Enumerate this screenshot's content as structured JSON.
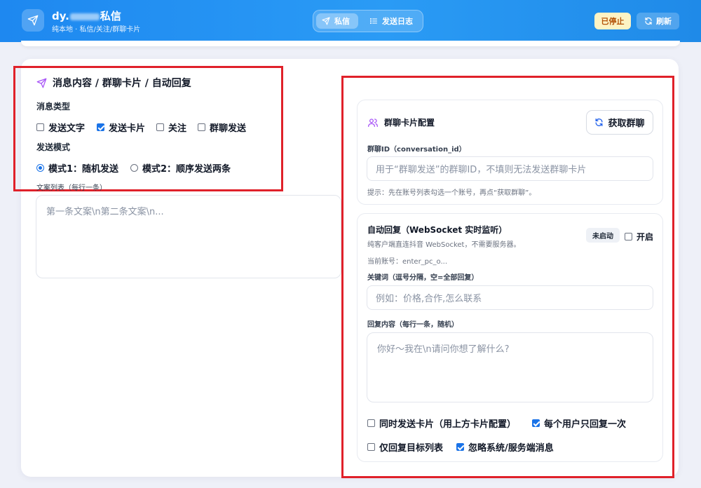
{
  "header": {
    "title_prefix": "dy.",
    "title_suffix": "私信",
    "subtitle": "纯本地 · 私信/关注/群聊卡片",
    "tabs": [
      {
        "label": "私信",
        "active": true
      },
      {
        "label": "发送日志",
        "active": false
      }
    ],
    "status_badge": "已停止",
    "refresh_label": "刷新"
  },
  "message_section": {
    "title": "消息内容 / 群聊卡片 / 自动回复",
    "type_label": "消息类型",
    "types": [
      {
        "label": "发送文字",
        "checked": false
      },
      {
        "label": "发送卡片",
        "checked": true
      },
      {
        "label": "关注",
        "checked": false
      },
      {
        "label": "群聊发送",
        "checked": false
      }
    ],
    "mode_label": "发送模式",
    "modes": [
      {
        "label": "模式1：随机发送",
        "checked": true
      },
      {
        "label": "模式2：顺序发送两条",
        "checked": false
      }
    ],
    "copy_list_label": "文案列表（每行一条）",
    "copy_list_placeholder": "第一条文案\\n第二条文案\\n..."
  },
  "group_card": {
    "title": "群聊卡片配置",
    "fetch_button": "获取群聊",
    "id_label": "群聊ID（conversation_id）",
    "id_placeholder": "用于“群聊发送”的群聊ID，不填则无法发送群聊卡片",
    "hint": "提示：先在账号列表勾选一个账号，再点“获取群聊”。"
  },
  "auto_reply": {
    "title": "自动回复（WebSocket 实时监听）",
    "description": "纯客户端直连抖音 WebSocket，不需要服务器。",
    "status": "未启动",
    "enable_label": "开启",
    "enable_checked": false,
    "current_account": "当前账号：enter_pc_o...",
    "keywords_label": "关键词（逗号分隔，空=全部回复）",
    "keywords_placeholder": "例如：价格,合作,怎么联系",
    "reply_label": "回复内容（每行一条，随机）",
    "reply_placeholder": "你好～我在\\n请问你想了解什么?",
    "options": [
      {
        "label": "同时发送卡片（用上方卡片配置）",
        "checked": false
      },
      {
        "label": "每个用户只回复一次",
        "checked": true
      },
      {
        "label": "仅回复目标列表",
        "checked": false
      },
      {
        "label": "忽略系统/服务端消息",
        "checked": true
      }
    ]
  }
}
